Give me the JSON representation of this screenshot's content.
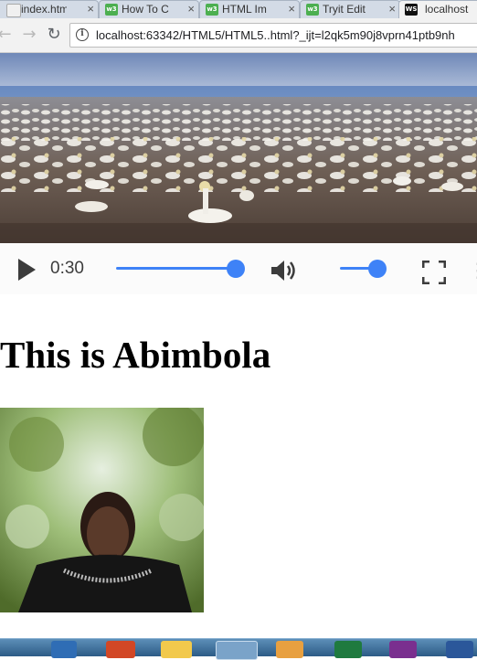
{
  "browser": {
    "tabs": [
      {
        "label": "index.htm",
        "icon": "page-icon",
        "active": false
      },
      {
        "label": "How To C",
        "icon": "w3schools-icon",
        "active": false
      },
      {
        "label": "HTML Im",
        "icon": "w3schools-icon",
        "active": false
      },
      {
        "label": "Tryit Edit",
        "icon": "w3schools-icon",
        "active": false
      },
      {
        "label": "localhost",
        "icon": "webstorm-icon",
        "active": true
      }
    ],
    "url": "localhost:63342/HTML5/HTML5..html?_ijt=l2qk5m90j8vprn41ptb9nh",
    "favicon_labels": {
      "w3": "w3",
      "ws": "WS"
    }
  },
  "video": {
    "current_time": "0:30",
    "progress": 0.85,
    "volume": 0.8,
    "colors": {
      "accent": "#3e82f7",
      "icon": "#3c3c3c"
    }
  },
  "page": {
    "heading": "This is Abimbola"
  },
  "taskbar": {
    "apps": [
      "ie-icon",
      "powerpoint-icon",
      "file-explorer-icon",
      "chrome-icon",
      "app-icon",
      "excel-icon",
      "onenote-icon",
      "word-icon"
    ]
  }
}
